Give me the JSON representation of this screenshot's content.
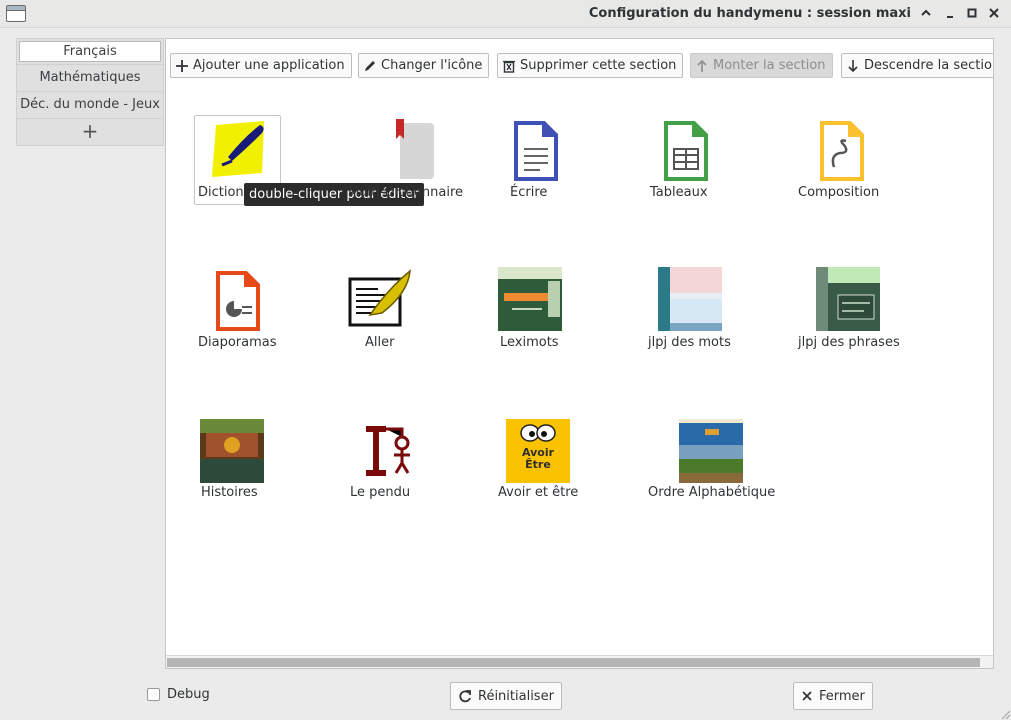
{
  "window": {
    "title": "Configuration du handymenu : session maxi"
  },
  "tabs": [
    {
      "label": "Français",
      "active": true
    },
    {
      "label": "Mathématiques",
      "active": false
    },
    {
      "label": "Déc. du monde - Jeux",
      "active": false
    },
    {
      "label": "+",
      "active": false
    }
  ],
  "toolbar": {
    "add_app": "Ajouter une application",
    "change_icon": "Changer l'icône",
    "delete_section": "Supprimer cette section",
    "move_up": "Monter la section",
    "move_down": "Descendre la sectio"
  },
  "apps": [
    {
      "label": "Dictionnaire",
      "icon": "dictionary-icon"
    },
    {
      "label": "Multi-Dictionnaire",
      "icon": "bookmark-book-icon"
    },
    {
      "label": "Écrire",
      "icon": "document-writer-icon"
    },
    {
      "label": "Tableaux",
      "icon": "spreadsheet-icon"
    },
    {
      "label": "Composition",
      "icon": "draw-icon"
    },
    {
      "label": "Diaporamas",
      "icon": "presentation-icon"
    },
    {
      "label": "Aller",
      "icon": "quill-letter-icon"
    },
    {
      "label": "Leximots",
      "icon": "leximots-screenshot-icon"
    },
    {
      "label": "jlpj des mots",
      "icon": "jlpj-mots-screenshot-icon"
    },
    {
      "label": "jlpj des phrases",
      "icon": "jlpj-phrases-screenshot-icon"
    },
    {
      "label": "Histoires",
      "icon": "stories-screenshot-icon"
    },
    {
      "label": "Le pendu",
      "icon": "hangman-icon"
    },
    {
      "label": "Avoir et être",
      "icon": "avoir-etre-icon",
      "icon_text": "Avoir Être"
    },
    {
      "label": "Ordre Alphabétique",
      "icon": "alphabetical-order-screenshot-icon"
    }
  ],
  "tooltip": "double-cliquer pour éditer",
  "bottom": {
    "debug_label": "Debug",
    "debug_checked": false,
    "reset_label": "Réinitialiser",
    "close_label": "Fermer"
  },
  "colors": {
    "writer_blue": "#3f51b5",
    "calc_green": "#43a047",
    "draw_yellow": "#fbc02d",
    "impress_orange": "#e64a19",
    "tooltip_bg": "#2b2b2b"
  }
}
